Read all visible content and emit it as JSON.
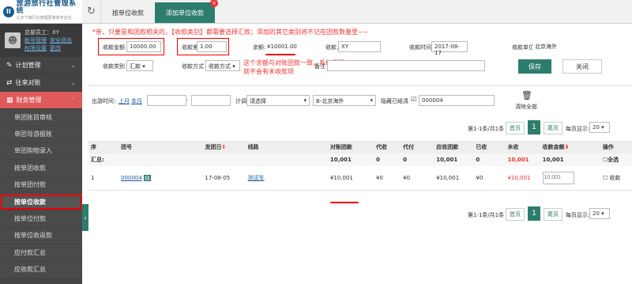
{
  "app": {
    "title": "旅游旅行社管理系统",
    "subtitle": "让天下旅行社管理更简单专业化",
    "logo_mark": "II"
  },
  "user": {
    "role": "总部员工：XY",
    "links": [
      "帐号管理",
      "安全退出"
    ],
    "links2": [
      "权限设置",
      "更改"
    ]
  },
  "menu": {
    "items": [
      {
        "label": "计划管理",
        "icon": "✎"
      },
      {
        "label": "往来对账",
        "icon": "⇄"
      },
      {
        "label": "财务管理",
        "icon": "▦"
      }
    ],
    "subitems": [
      "单团账目审核",
      "单团导游报账",
      "单团购物录入",
      "按单团收款",
      "按单团付款",
      "按单位收款",
      "按单位付款",
      "按单位收返款",
      "应付款汇总",
      "应收款汇总"
    ]
  },
  "tabs": [
    "按单位收款",
    "添加单位收款"
  ],
  "form": {
    "notice": "*亲，只要是和团款相关的，【收款类别】都需要选择汇款；添加的其它类别将不记在团款数量里~~",
    "amount_label": "收款金额",
    "amount_value": "10000.00",
    "diff_label": "收款差额",
    "diff_value": "1.00",
    "balance_label": "余额:",
    "balance_value": "¥10001.00",
    "payer_label": "收款人",
    "payer_value": "XY",
    "date_label": "收款时间",
    "date_value": "2017-08-17",
    "unit_label": "收款单位",
    "unit_value": "北京海外",
    "type_label": "收款类别",
    "type_value": "汇款",
    "method_label": "收款方式",
    "method_value": "收款方式",
    "annotation": "这个余额与对账团款一致，系统里面就不会有未收款项",
    "remark_label": "备注",
    "save": "保存",
    "close": "关闭"
  },
  "filter": {
    "time_label": "出游时间：",
    "last_month": "上月",
    "this_month": "本月",
    "plan_label": "计调:",
    "plan_value": "请选择",
    "unit_value": "B-北京海外",
    "hide_label": "隐藏已结清",
    "search_value": "000004",
    "clear_label": "清除全部"
  },
  "pager": {
    "info": "第1-1条/共1条",
    "first": "首页",
    "current": "1",
    "last": "尾页",
    "per_page_label": "每页显示:",
    "per_page": "20"
  },
  "table": {
    "headers": [
      "序",
      "团号",
      "发团日",
      "线路",
      "对账团款",
      "代收",
      "代付",
      "应收团款",
      "已收",
      "未收",
      "收款金额",
      "操作"
    ],
    "sum_row": {
      "label": "汇总:",
      "recon": "10,001",
      "daishou": "0",
      "daifu": "0",
      "due": "10,001",
      "received": "0",
      "unpaid": "10,001",
      "amount": "10,001",
      "op": "全选"
    },
    "rows": [
      {
        "idx": "1",
        "group": "000004",
        "date": "17-08-05",
        "route": "测试车",
        "recon": "¥10,001",
        "daishou": "¥0",
        "daifu": "¥0",
        "due": "¥10,001",
        "received": "¥0",
        "unpaid": "¥10,001",
        "amount_placeholder": "10,001",
        "op": "收款"
      }
    ]
  },
  "colors": {
    "accent": "#2d7d6e",
    "red": "#e33333",
    "sidebar": "#444444"
  }
}
